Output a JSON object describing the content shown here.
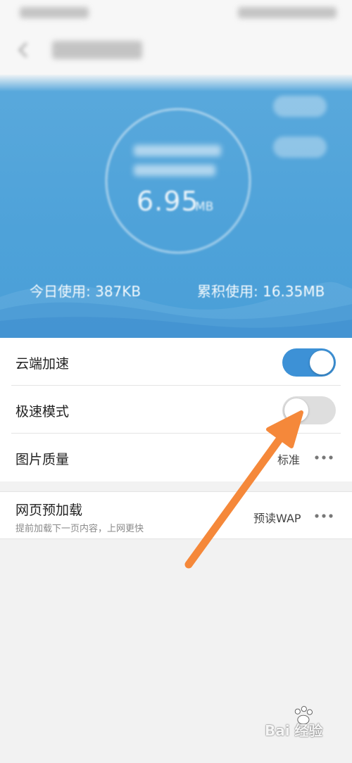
{
  "hero": {
    "data_value": "6.95",
    "data_unit": "MB",
    "today_usage": "今日使用: 387KB",
    "total_usage": "累积使用: 16.35MB"
  },
  "settings": {
    "items": [
      {
        "label": "云端加速",
        "toggle": "on"
      },
      {
        "label": "极速模式",
        "toggle": "off"
      },
      {
        "label": "图片质量",
        "value": "标准"
      }
    ],
    "preload": {
      "label": "网页预加载",
      "subtitle": "提前加载下一页内容，上网更快",
      "value": "预读WAP"
    }
  },
  "annotation": {
    "color": "#f5883a"
  },
  "watermark": {
    "text": "Bai 经验"
  },
  "colors": {
    "accent_blue": "#3d91d6",
    "hero_blue": "#4ea2d9",
    "toggle_off": "#dedede"
  }
}
